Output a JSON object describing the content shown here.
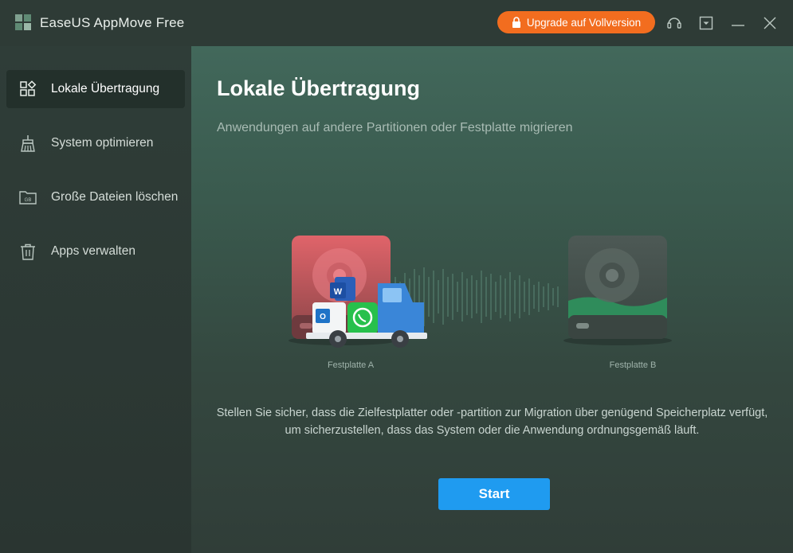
{
  "app": {
    "title": "EaseUS AppMove Free",
    "upgrade_label": "Upgrade auf Vollversion"
  },
  "titlebar_icons": [
    "headset-icon",
    "dropdown-menu-icon",
    "minimize-icon",
    "close-icon"
  ],
  "sidebar": {
    "items": [
      {
        "label": "Lokale Übertragung",
        "icon": "local-transfer-icon",
        "active": true
      },
      {
        "label": "System optimieren",
        "icon": "broom-icon",
        "active": false
      },
      {
        "label": "Große Dateien löschen",
        "icon": "large-files-icon",
        "active": false
      },
      {
        "label": "Apps verwalten",
        "icon": "trash-icon",
        "active": false
      }
    ]
  },
  "main": {
    "title": "Lokale Übertragung",
    "subtitle": "Anwendungen auf andere Partitionen oder Festplatte migrieren",
    "disk_a_label": "Festplatte A",
    "disk_b_label": "Festplatte B",
    "truck_word_letter": "W",
    "truck_outlook_letter": "O",
    "info_text": "Stellen Sie sicher, dass die Zielfestplatter oder -partition zur Migration über genügend Speicherplatz verfügt, um sicherzustellen, dass das System oder die Anwendung ordnungsgemäß läuft.",
    "start_label": "Start"
  },
  "colors": {
    "accent_orange": "#f26d1f",
    "accent_blue": "#1f9bf0",
    "disk_a_red": "#d9545a",
    "disk_b_green": "#3ea16d"
  }
}
